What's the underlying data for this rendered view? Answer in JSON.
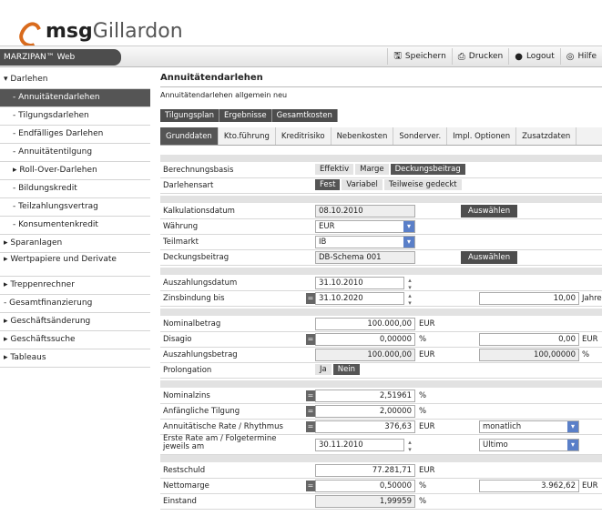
{
  "brand": {
    "name_bold": "msg",
    "name_rest": "Gillardon"
  },
  "app_name": "MARZIPAN™ Web",
  "toolbar": [
    {
      "label": "Speichern",
      "icon": "save-icon",
      "glyph": "🖫"
    },
    {
      "label": "Drucken",
      "icon": "print-icon",
      "glyph": "⎙"
    },
    {
      "label": "Logout",
      "icon": "logout-icon",
      "glyph": "●"
    },
    {
      "label": "Hilfe",
      "icon": "help-icon",
      "glyph": "◎"
    }
  ],
  "sidebar": [
    {
      "label": "▾ Darlehen",
      "sub": false
    },
    {
      "label": "- Annuitätendarlehen",
      "sub": true,
      "active": true
    },
    {
      "label": "- Tilgungsdarlehen",
      "sub": true
    },
    {
      "label": "- Endfälliges Darlehen",
      "sub": true
    },
    {
      "label": "- Annuitätentilgung",
      "sub": true
    },
    {
      "label": "▸ Roll-Over-Darlehen",
      "sub": true
    },
    {
      "label": "- Bildungskredit",
      "sub": true
    },
    {
      "label": "- Teilzahlungsvertrag",
      "sub": true
    },
    {
      "label": "- Konsumentenkredit",
      "sub": true
    },
    {
      "label": "▸ Sparanlagen",
      "sub": false
    },
    {
      "label": "▸ Wertpapiere und Derivate",
      "sub": false,
      "two": true
    },
    {
      "label": "▸ Treppenrechner",
      "sub": false
    },
    {
      "label": "- Gesamtfinanzierung",
      "sub": false
    },
    {
      "label": "▸ Geschäftsänderung",
      "sub": false
    },
    {
      "label": "▸ Geschäftssuche",
      "sub": false
    },
    {
      "label": "▸ Tableaus",
      "sub": false
    }
  ],
  "main": {
    "title": "Annuitätendarlehen",
    "subtitle": "Annuitätendarlehen allgemein neu",
    "tabs": [
      "Tilgungsplan",
      "Ergebnisse",
      "Gesamtkosten"
    ],
    "tabs2": [
      {
        "label": "Grunddaten",
        "active": true
      },
      {
        "label": "Kto.führung"
      },
      {
        "label": "Kreditrisiko"
      },
      {
        "label": "Nebenkosten"
      },
      {
        "label": "Sonderver."
      },
      {
        "label": "Impl. Optionen"
      },
      {
        "label": "Zusatzdaten"
      }
    ],
    "berechnungsbasis": {
      "label": "Berechnungsbasis",
      "options": [
        "Effektiv",
        "Marge",
        "Deckungsbeitrag"
      ],
      "selected": 2
    },
    "darlehensart": {
      "label": "Darlehensart",
      "options": [
        "Fest",
        "Variabel",
        "Teilweise gedeckt"
      ],
      "selected": 0
    },
    "kalkulationsdatum": {
      "label": "Kalkulationsdatum",
      "value": "08.10.2010",
      "button": "Auswählen"
    },
    "waehrung": {
      "label": "Währung",
      "value": "EUR"
    },
    "teilmarkt": {
      "label": "Teilmarkt",
      "value": "IB"
    },
    "deckungsbeitrag": {
      "label": "Deckungsbeitrag",
      "value": "DB-Schema 001",
      "button": "Auswählen"
    },
    "auszahlungsdatum": {
      "label": "Auszahlungsdatum",
      "value": "31.10.2010"
    },
    "zinsbindung": {
      "label": "Zinsbindung bis",
      "value": "31.10.2020",
      "years": "10,00",
      "unit": "Jahre"
    },
    "nominalbetrag": {
      "label": "Nominalbetrag",
      "value": "100.000,00",
      "unit": "EUR"
    },
    "disagio": {
      "label": "Disagio",
      "value": "0,00000",
      "unit": "%",
      "amount": "0,00",
      "amount_unit": "EUR"
    },
    "auszahlungsbetrag": {
      "label": "Auszahlungsbetrag",
      "value": "100.000,00",
      "unit": "EUR",
      "pct": "100,00000",
      "pct_unit": "%"
    },
    "prolongation": {
      "label": "Prolongation",
      "options": [
        "Ja",
        "Nein"
      ],
      "selected": 1
    },
    "nominalzins": {
      "label": "Nominalzins",
      "value": "2,51961",
      "unit": "%"
    },
    "tilgung": {
      "label": "Anfängliche Tilgung",
      "value": "2,00000",
      "unit": "%"
    },
    "rate": {
      "label": "Annuitätische Rate / Rhythmus",
      "value": "376,63",
      "unit": "EUR",
      "rhythm": "monatlich"
    },
    "ersterate": {
      "label": "Erste Rate am / Folgetermine jeweils am",
      "value": "30.11.2010",
      "folge": "Ultimo"
    },
    "restschuld": {
      "label": "Restschuld",
      "value": "77.281,71",
      "unit": "EUR"
    },
    "nettomarge": {
      "label": "Nettomarge",
      "value": "0,50000",
      "unit": "%",
      "amount": "3.962,62",
      "amount_unit": "EUR"
    },
    "einstand": {
      "label": "Einstand",
      "value": "1,99959",
      "unit": "%"
    }
  }
}
